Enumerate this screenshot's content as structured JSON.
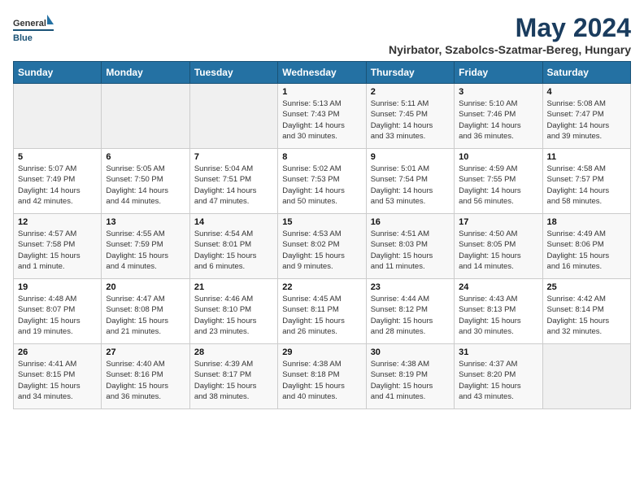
{
  "logo": {
    "general": "General",
    "blue": "Blue"
  },
  "title": "May 2024",
  "location": "Nyirbator, Szabolcs-Szatmar-Bereg, Hungary",
  "headers": [
    "Sunday",
    "Monday",
    "Tuesday",
    "Wednesday",
    "Thursday",
    "Friday",
    "Saturday"
  ],
  "weeks": [
    [
      {
        "num": "",
        "info": ""
      },
      {
        "num": "",
        "info": ""
      },
      {
        "num": "",
        "info": ""
      },
      {
        "num": "1",
        "info": "Sunrise: 5:13 AM\nSunset: 7:43 PM\nDaylight: 14 hours\nand 30 minutes."
      },
      {
        "num": "2",
        "info": "Sunrise: 5:11 AM\nSunset: 7:45 PM\nDaylight: 14 hours\nand 33 minutes."
      },
      {
        "num": "3",
        "info": "Sunrise: 5:10 AM\nSunset: 7:46 PM\nDaylight: 14 hours\nand 36 minutes."
      },
      {
        "num": "4",
        "info": "Sunrise: 5:08 AM\nSunset: 7:47 PM\nDaylight: 14 hours\nand 39 minutes."
      }
    ],
    [
      {
        "num": "5",
        "info": "Sunrise: 5:07 AM\nSunset: 7:49 PM\nDaylight: 14 hours\nand 42 minutes."
      },
      {
        "num": "6",
        "info": "Sunrise: 5:05 AM\nSunset: 7:50 PM\nDaylight: 14 hours\nand 44 minutes."
      },
      {
        "num": "7",
        "info": "Sunrise: 5:04 AM\nSunset: 7:51 PM\nDaylight: 14 hours\nand 47 minutes."
      },
      {
        "num": "8",
        "info": "Sunrise: 5:02 AM\nSunset: 7:53 PM\nDaylight: 14 hours\nand 50 minutes."
      },
      {
        "num": "9",
        "info": "Sunrise: 5:01 AM\nSunset: 7:54 PM\nDaylight: 14 hours\nand 53 minutes."
      },
      {
        "num": "10",
        "info": "Sunrise: 4:59 AM\nSunset: 7:55 PM\nDaylight: 14 hours\nand 56 minutes."
      },
      {
        "num": "11",
        "info": "Sunrise: 4:58 AM\nSunset: 7:57 PM\nDaylight: 14 hours\nand 58 minutes."
      }
    ],
    [
      {
        "num": "12",
        "info": "Sunrise: 4:57 AM\nSunset: 7:58 PM\nDaylight: 15 hours\nand 1 minute."
      },
      {
        "num": "13",
        "info": "Sunrise: 4:55 AM\nSunset: 7:59 PM\nDaylight: 15 hours\nand 4 minutes."
      },
      {
        "num": "14",
        "info": "Sunrise: 4:54 AM\nSunset: 8:01 PM\nDaylight: 15 hours\nand 6 minutes."
      },
      {
        "num": "15",
        "info": "Sunrise: 4:53 AM\nSunset: 8:02 PM\nDaylight: 15 hours\nand 9 minutes."
      },
      {
        "num": "16",
        "info": "Sunrise: 4:51 AM\nSunset: 8:03 PM\nDaylight: 15 hours\nand 11 minutes."
      },
      {
        "num": "17",
        "info": "Sunrise: 4:50 AM\nSunset: 8:05 PM\nDaylight: 15 hours\nand 14 minutes."
      },
      {
        "num": "18",
        "info": "Sunrise: 4:49 AM\nSunset: 8:06 PM\nDaylight: 15 hours\nand 16 minutes."
      }
    ],
    [
      {
        "num": "19",
        "info": "Sunrise: 4:48 AM\nSunset: 8:07 PM\nDaylight: 15 hours\nand 19 minutes."
      },
      {
        "num": "20",
        "info": "Sunrise: 4:47 AM\nSunset: 8:08 PM\nDaylight: 15 hours\nand 21 minutes."
      },
      {
        "num": "21",
        "info": "Sunrise: 4:46 AM\nSunset: 8:10 PM\nDaylight: 15 hours\nand 23 minutes."
      },
      {
        "num": "22",
        "info": "Sunrise: 4:45 AM\nSunset: 8:11 PM\nDaylight: 15 hours\nand 26 minutes."
      },
      {
        "num": "23",
        "info": "Sunrise: 4:44 AM\nSunset: 8:12 PM\nDaylight: 15 hours\nand 28 minutes."
      },
      {
        "num": "24",
        "info": "Sunrise: 4:43 AM\nSunset: 8:13 PM\nDaylight: 15 hours\nand 30 minutes."
      },
      {
        "num": "25",
        "info": "Sunrise: 4:42 AM\nSunset: 8:14 PM\nDaylight: 15 hours\nand 32 minutes."
      }
    ],
    [
      {
        "num": "26",
        "info": "Sunrise: 4:41 AM\nSunset: 8:15 PM\nDaylight: 15 hours\nand 34 minutes."
      },
      {
        "num": "27",
        "info": "Sunrise: 4:40 AM\nSunset: 8:16 PM\nDaylight: 15 hours\nand 36 minutes."
      },
      {
        "num": "28",
        "info": "Sunrise: 4:39 AM\nSunset: 8:17 PM\nDaylight: 15 hours\nand 38 minutes."
      },
      {
        "num": "29",
        "info": "Sunrise: 4:38 AM\nSunset: 8:18 PM\nDaylight: 15 hours\nand 40 minutes."
      },
      {
        "num": "30",
        "info": "Sunrise: 4:38 AM\nSunset: 8:19 PM\nDaylight: 15 hours\nand 41 minutes."
      },
      {
        "num": "31",
        "info": "Sunrise: 4:37 AM\nSunset: 8:20 PM\nDaylight: 15 hours\nand 43 minutes."
      },
      {
        "num": "",
        "info": ""
      }
    ]
  ]
}
